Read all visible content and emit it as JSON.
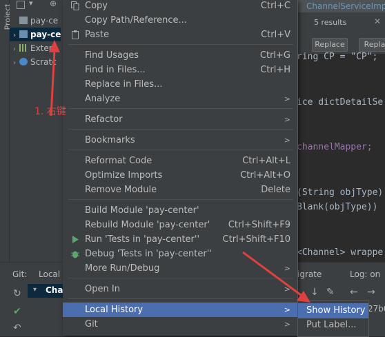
{
  "colors": {
    "accent": "#4b6eaf",
    "annotation": "#e04040"
  },
  "project_strip": {
    "label": "Project"
  },
  "tree": {
    "items": [
      {
        "label": "pay-ce",
        "icon": "folder-icon"
      },
      {
        "label": "pay-ce",
        "icon": "module-icon"
      },
      {
        "label": "Extern",
        "icon": "libraries-icon"
      },
      {
        "label": "Scratc",
        "icon": "scratches-icon"
      }
    ]
  },
  "editor": {
    "tab_label": "ChannelServiceImp",
    "find_results": "5 results",
    "replace_label": "Replace",
    "replace_all_label": "Replac",
    "code_lines": [
      {
        "text": "ring CP = \"CP\";"
      },
      {
        "text": "ice dictDetailSe"
      },
      {
        "text": "channelMapper;"
      },
      {
        "text": "(String objType)"
      },
      {
        "text": "Blank(objType))"
      },
      {
        "text": "<Channel> wrappe"
      }
    ]
  },
  "git": {
    "tab_git": "Git:",
    "tab_local": "Local",
    "branch": "Cha",
    "tab_migrate": "igrate",
    "tab_log": "Log: on",
    "hash": "27b0"
  },
  "menu": {
    "items": [
      {
        "label": "Copy",
        "shortcut": "Ctrl+C"
      },
      {
        "label": "Copy Path/Reference...",
        "shortcut": ""
      },
      {
        "label": "Paste",
        "shortcut": "Ctrl+V"
      },
      {
        "label": "Find Usages",
        "shortcut": "Ctrl+G"
      },
      {
        "label": "Find in Files...",
        "shortcut": "Ctrl+H"
      },
      {
        "label": "Replace in Files...",
        "shortcut": ""
      },
      {
        "label": "Analyze",
        "shortcut": ""
      },
      {
        "label": "Refactor",
        "shortcut": ""
      },
      {
        "label": "Bookmarks",
        "shortcut": ""
      },
      {
        "label": "Reformat Code",
        "shortcut": "Ctrl+Alt+L"
      },
      {
        "label": "Optimize Imports",
        "shortcut": "Ctrl+Alt+O"
      },
      {
        "label": "Remove Module",
        "shortcut": "Delete"
      },
      {
        "label": "Build Module 'pay-center'",
        "shortcut": ""
      },
      {
        "label": "Rebuild Module 'pay-center'",
        "shortcut": "Ctrl+Shift+F9"
      },
      {
        "label": "Run 'Tests in 'pay-center''",
        "shortcut": "Ctrl+Shift+F10"
      },
      {
        "label": "Debug 'Tests in 'pay-center''",
        "shortcut": ""
      },
      {
        "label": "More Run/Debug",
        "shortcut": ""
      },
      {
        "label": "Open In",
        "shortcut": ""
      },
      {
        "label": "Local History",
        "shortcut": ""
      },
      {
        "label": "Git",
        "shortcut": ""
      }
    ],
    "submenu_arrow": ">"
  },
  "submenu": {
    "items": [
      {
        "label": "Show History"
      },
      {
        "label": "Put Label..."
      }
    ]
  },
  "annotation": {
    "text": "1. 右键"
  }
}
